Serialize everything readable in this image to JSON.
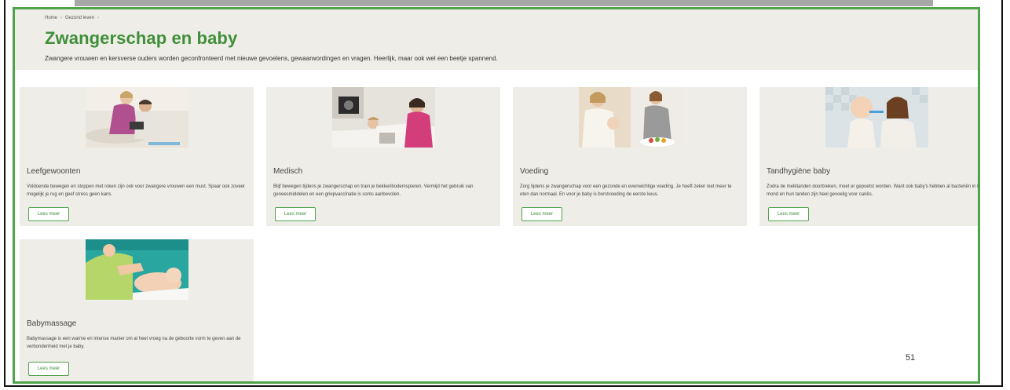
{
  "breadcrumb": [
    "Home",
    "Gezond leven"
  ],
  "breadcrumb_sep": "›",
  "title": "Zwangerschap en baby",
  "intro": "Zwangere vrouwen en kersverse ouders worden geconfronteerd met nieuwe gevoelens, gewaarwordingen en vragen. Heerlijk, maar ook wel een beetje spannend.",
  "cards": [
    {
      "title": "Leefgewoonten",
      "text": "Voldoende bewegen en stoppen met roken zijn ook voor zwangere vrouwen een must. Spaar ook zoveel mogelijk je rug en geef stress geen kans.",
      "button": "Lees meer"
    },
    {
      "title": "Medisch",
      "text": "Blijf bewegen tijdens je zwangerschap en train je bekkenbodemspieren. Vermijd het gebruik van geneesmiddelen en een griepvaccinatie is soms aanbevolen.",
      "button": "Lees meer"
    },
    {
      "title": "Voeding",
      "text": "Zorg tijdens je zwangerschap voor een gezonde en evenwichtige voeding. Je hoeft zeker niet meer te eten dan normaal. En voor je baby is borstvoeding de eerste keus.",
      "button": "Lees meer"
    },
    {
      "title": "Tandhygiëne baby",
      "text": "Zodra de melktanden doorbreken, moet er gepoetst worden. Want ook baby's hebben al bacteriën in hun mond en hun tanden zijn heel gevoelig voor cariës.",
      "button": "Lees meer"
    },
    {
      "title": "Babymassage",
      "text": "Babymassage is een warme en intense manier om al heel vroeg na de geboorte vorm te geven aan de verbondenheid met je baby.",
      "button": "Lees meer"
    }
  ],
  "page_number": "51",
  "colors": {
    "accent": "#3f8f3a",
    "frame": "#4fa34a",
    "panel": "#efede7"
  }
}
